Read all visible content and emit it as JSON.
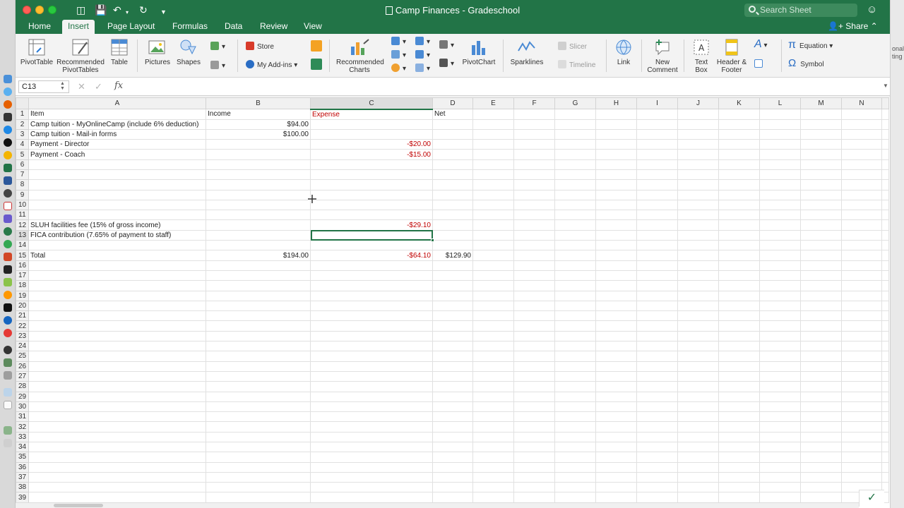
{
  "window": {
    "title": "Camp Finances - Gradeschool",
    "search_placeholder": "Search Sheet",
    "share_label": "Share"
  },
  "ribbon_tabs": [
    {
      "label": "Home",
      "active": false
    },
    {
      "label": "Insert",
      "active": true
    },
    {
      "label": "Page Layout",
      "active": false
    },
    {
      "label": "Formulas",
      "active": false
    },
    {
      "label": "Data",
      "active": false
    },
    {
      "label": "Review",
      "active": false
    },
    {
      "label": "View",
      "active": false
    }
  ],
  "ribbon": {
    "pivottable": "PivotTable",
    "recommended_pivottables_1": "Recommended",
    "recommended_pivottables_2": "PivotTables",
    "table": "Table",
    "pictures": "Pictures",
    "shapes": "Shapes",
    "store": "Store",
    "my_addins": "My Add-ins",
    "recommended_charts_1": "Recommended",
    "recommended_charts_2": "Charts",
    "pivotchart": "PivotChart",
    "sparklines": "Sparklines",
    "slicer": "Slicer",
    "timeline": "Timeline",
    "link": "Link",
    "new_comment_1": "New",
    "new_comment_2": "Comment",
    "text_box_1": "Text",
    "text_box_2": "Box",
    "header_footer_1": "Header &",
    "header_footer_2": "Footer",
    "equation": "Equation",
    "symbol": "Symbol"
  },
  "formula_bar": {
    "name_box": "C13",
    "fx": "fx",
    "value": ""
  },
  "sheet": {
    "columns": [
      "A",
      "B",
      "C",
      "D",
      "E",
      "F",
      "G",
      "H",
      "I",
      "J",
      "K",
      "L",
      "M",
      "N"
    ],
    "active_column": "C",
    "active_row": 13,
    "row_count": 39,
    "cells": {
      "A1": "Item",
      "B1": "Income",
      "C1": "Expense",
      "D1": "Net",
      "A2": "Camp tuition - MyOnlineCamp (include 6% deduction)",
      "B2": "$94.00",
      "A3": "Camp tuition - Mail-in forms",
      "B3": "$100.00",
      "A4": "Payment - Director",
      "C4": "-$20.00",
      "A5": "Payment - Coach",
      "C5": "-$15.00",
      "A12": "SLUH facilities fee (15% of gross income)",
      "C12": "-$29.10",
      "A13": "FICA contribution (7.65% of payment to staff)",
      "A15": "Total",
      "B15": "$194.00",
      "C15": "-$64.10",
      "D15": "$129.90"
    }
  },
  "right_edge_text": [
    "onal",
    "ting"
  ],
  "colors": {
    "excel_green": "#227447",
    "negative_red": "#c00000"
  }
}
